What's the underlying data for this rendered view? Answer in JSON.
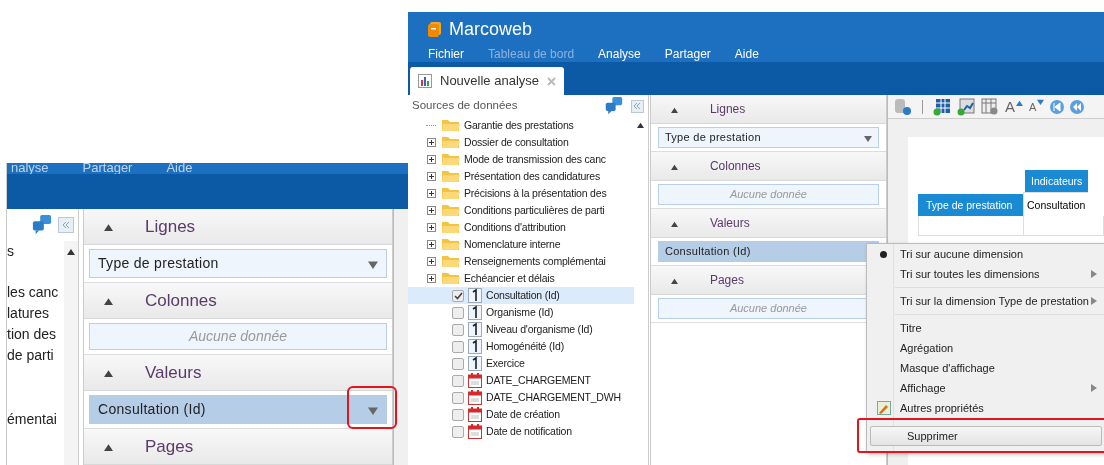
{
  "inset": {
    "menu": [
      {
        "label": "nalyse"
      },
      {
        "label": "Partager"
      },
      {
        "label": "Aide"
      }
    ],
    "tree_fragments": [
      "s",
      "les canc",
      "latures",
      "tion des",
      "de parti",
      "émentai"
    ],
    "sections": [
      {
        "title": "Lignes",
        "field": {
          "kind": "item",
          "text": "Type de prestation",
          "selected": false
        }
      },
      {
        "title": "Colonnes",
        "field": {
          "kind": "empty",
          "text": "Aucune donnée"
        }
      },
      {
        "title": "Valeurs",
        "field": {
          "kind": "item",
          "text": "Consultation (Id)",
          "selected": true,
          "highlighted": true
        }
      },
      {
        "title": "Pages"
      }
    ]
  },
  "app": {
    "title": "Marcoweb",
    "menu": [
      {
        "label": "Fichier",
        "disabled": false
      },
      {
        "label": "Tableau de bord",
        "disabled": true
      },
      {
        "label": "Analyse",
        "disabled": false
      },
      {
        "label": "Partager",
        "disabled": false
      },
      {
        "label": "Aide",
        "disabled": false
      }
    ],
    "tab": {
      "label": "Nouvelle analyse"
    },
    "sources": {
      "title": "Sources de données",
      "tree": [
        {
          "kind": "folder",
          "label": "Garantie des prestations",
          "expandable": false
        },
        {
          "kind": "folder",
          "label": "Dossier de consultation",
          "expandable": true
        },
        {
          "kind": "folder",
          "label": "Mode de transmission des canc",
          "expandable": true
        },
        {
          "kind": "folder",
          "label": "Présentation des candidatures",
          "expandable": true
        },
        {
          "kind": "folder",
          "label": "Précisions à la présentation des",
          "expandable": true
        },
        {
          "kind": "folder",
          "label": "Conditions particulières de parti",
          "expandable": true
        },
        {
          "kind": "folder",
          "label": "Conditions d'attribution",
          "expandable": true
        },
        {
          "kind": "folder",
          "label": "Nomenclature interne",
          "expandable": true
        },
        {
          "kind": "folder",
          "label": "Renseignements complémentai",
          "expandable": true
        },
        {
          "kind": "folder",
          "label": "Echéancier et délais",
          "expandable": true
        },
        {
          "kind": "measure",
          "label": "Consultation (Id)",
          "checked": true,
          "selected": true
        },
        {
          "kind": "measure",
          "label": "Organisme (Id)",
          "checked": false,
          "selected": false
        },
        {
          "kind": "measure",
          "label": "Niveau d'organisme (Id)",
          "checked": false,
          "selected": false
        },
        {
          "kind": "measure",
          "label": "Homogénéité (Id)",
          "checked": false,
          "selected": false
        },
        {
          "kind": "measure",
          "label": "Exercice",
          "checked": false,
          "selected": false
        },
        {
          "kind": "date",
          "label": "DATE_CHARGEMENT",
          "checked": false,
          "selected": false
        },
        {
          "kind": "date",
          "label": "DATE_CHARGEMENT_DWH",
          "checked": false,
          "selected": false
        },
        {
          "kind": "date",
          "label": "Date de création",
          "checked": false,
          "selected": false
        },
        {
          "kind": "date",
          "label": "Date de notification",
          "checked": false,
          "selected": false
        }
      ]
    },
    "sections": [
      {
        "title": "Lignes",
        "field": {
          "kind": "item",
          "text": "Type de prestation",
          "selected": false
        }
      },
      {
        "title": "Colonnes",
        "field": {
          "kind": "empty",
          "text": "Aucune donnée"
        }
      },
      {
        "title": "Valeurs",
        "field": {
          "kind": "item",
          "text": "Consultation (Id)",
          "selected": true
        }
      },
      {
        "title": "Pages",
        "field": {
          "kind": "empty",
          "text": "Aucune donnée"
        }
      }
    ],
    "toolbar": [
      {
        "kind": "database"
      },
      {
        "kind": "separator"
      },
      {
        "kind": "add-table"
      },
      {
        "kind": "add-chart"
      },
      {
        "kind": "grid-settings"
      },
      {
        "kind": "font-up",
        "label": "A"
      },
      {
        "kind": "font-down",
        "label": "A"
      },
      {
        "kind": "first"
      },
      {
        "kind": "prev"
      }
    ],
    "table": {
      "group_header": "Indicateurs",
      "row_header": "Type de prestation",
      "column": "Consultation"
    },
    "context_menu": [
      {
        "kind": "item",
        "label": "Tri sur aucune dimension",
        "selected": true,
        "submenu": false
      },
      {
        "kind": "item",
        "label": "Tri sur toutes les dimensions",
        "selected": false,
        "submenu": true
      },
      {
        "kind": "separator"
      },
      {
        "kind": "item",
        "label": "Tri sur la dimension Type de prestation",
        "selected": false,
        "submenu": true
      },
      {
        "kind": "separator"
      },
      {
        "kind": "item",
        "label": "Titre",
        "selected": false,
        "submenu": false
      },
      {
        "kind": "item",
        "label": "Agrégation",
        "selected": false,
        "submenu": false
      },
      {
        "kind": "item",
        "label": "Masque d'affichage",
        "selected": false,
        "submenu": false
      },
      {
        "kind": "item",
        "label": "Affichage",
        "selected": false,
        "submenu": true
      },
      {
        "kind": "icon-item",
        "label": "Autres propriétés",
        "selected": false,
        "submenu": false
      },
      {
        "kind": "button",
        "label": "Supprimer",
        "highlighted": true
      }
    ]
  }
}
